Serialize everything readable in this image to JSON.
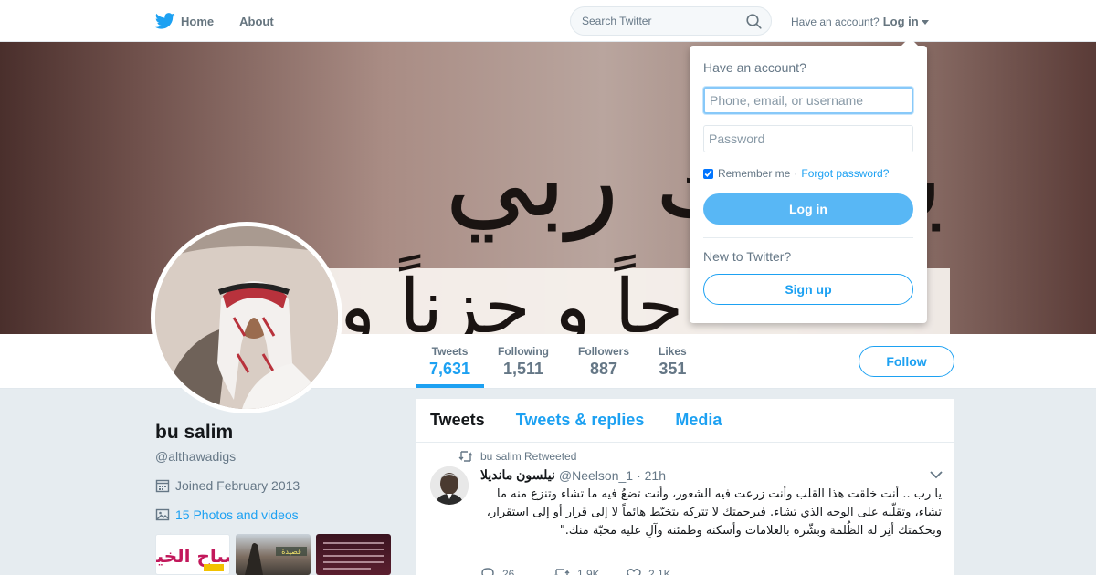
{
  "nav": {
    "home_label": "Home",
    "about_label": "About",
    "search_placeholder": "Search Twitter",
    "account_prompt": "Have an account?",
    "login_label": "Log in"
  },
  "profile": {
    "name": "bu salim",
    "handle": "@althawadigs",
    "joined": "Joined February 2013",
    "photos_link": "15 Photos and videos",
    "follow_label": "Follow",
    "thumb1_text": "صباح الخير",
    "thumb2_text": "قصيدة",
    "banner_text_top": "يغفرك ربي",
    "banner_text_bottom": "حاً و حزناً و"
  },
  "stats": [
    {
      "label": "Tweets",
      "value": "7,631",
      "active": true
    },
    {
      "label": "Following",
      "value": "1,511",
      "active": false
    },
    {
      "label": "Followers",
      "value": "887",
      "active": false
    },
    {
      "label": "Likes",
      "value": "351",
      "active": false
    }
  ],
  "timeline": {
    "tabs": [
      "Tweets",
      "Tweets & replies",
      "Media"
    ],
    "active_tab": "Tweets"
  },
  "tweet": {
    "retweet_context": "bu salim Retweeted",
    "author_name": "نيلسون مانديلا",
    "author_handle": "@Neelson_1",
    "time": "· 21h",
    "text": "يا رب .. أنت خلقت هذا القلب وأنت زرعت فيه الشعور، وأنت تضعُ فيه ما تشاء وتنزع منه ما تشاء، وتقلّبه على الوجه الذي تشاء. فبرحمتك لا تتركه يتخبّط هائماً لا إلى قرار أو إلى استقرار، وبحكمتك أنِر له الظُلمة وبشّره بالعلامات وأسكنه وطمئنه وآلِ عليه محبّة منك.\"",
    "replies": "26",
    "retweets": "1.9K",
    "likes": "2.1K"
  },
  "login": {
    "heading": "Have an account?",
    "username_placeholder": "Phone, email, or username",
    "password_placeholder": "Password",
    "remember_label": "Remember me",
    "separator": "·",
    "forgot_label": "Forgot password?",
    "login_button": "Log in",
    "new_prompt": "New to Twitter?",
    "signup_button": "Sign up"
  },
  "colors": {
    "accent": "#1da1f2",
    "login_button": "#58b7f5",
    "background": "#e6ecf0"
  }
}
